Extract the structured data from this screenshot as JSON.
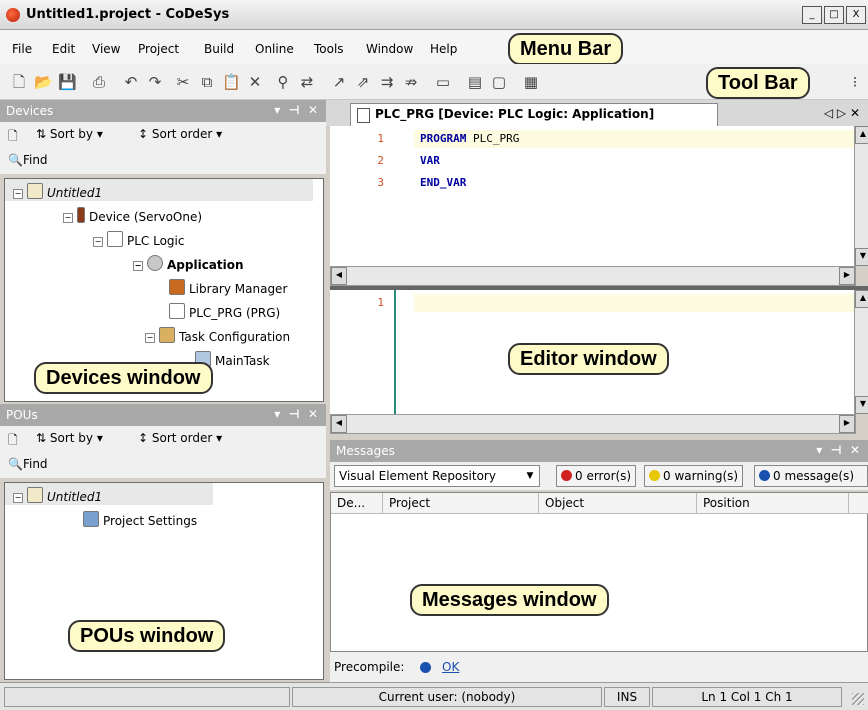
{
  "window": {
    "title": "Untitled1.project - CoDeSys",
    "buttons": [
      "_",
      "□",
      "X"
    ]
  },
  "menu": [
    "File",
    "Edit",
    "View",
    "Project",
    "Build",
    "Online",
    "Tools",
    "Window",
    "Help"
  ],
  "callouts": {
    "menu_bar": "Menu Bar",
    "tool_bar": "Tool Bar",
    "devices_window": "Devices window",
    "editor_window": "Editor window",
    "messages_window": "Messages window",
    "pous_window": "POUs window"
  },
  "devices": {
    "title": "Devices",
    "sort_by": "Sort by",
    "sort_order": "Sort order",
    "find": "Find",
    "tree": [
      {
        "label": "Untitled1",
        "style": "italic"
      },
      {
        "label": "Device (ServoOne)"
      },
      {
        "label": "PLC Logic"
      },
      {
        "label": "Application",
        "style": "bold"
      },
      {
        "label": "Library Manager"
      },
      {
        "label": "PLC_PRG (PRG)"
      },
      {
        "label": "Task Configuration"
      },
      {
        "label": "MainTask"
      }
    ]
  },
  "pous": {
    "title": "POUs",
    "sort_by": "Sort by",
    "sort_order": "Sort order",
    "find": "Find",
    "tree": [
      {
        "label": "Untitled1",
        "style": "italic"
      },
      {
        "label": "Project Settings"
      }
    ]
  },
  "editor": {
    "tab": "PLC_PRG [Device: PLC Logic: Application]",
    "top_lines": [
      {
        "n": "1",
        "kw": "PROGRAM",
        "rest": " PLC_PRG"
      },
      {
        "n": "2",
        "kw": "VAR",
        "rest": ""
      },
      {
        "n": "3",
        "kw": "END_VAR",
        "rest": ""
      }
    ],
    "bottom_lines": [
      {
        "n": "1"
      }
    ]
  },
  "messages": {
    "title": "Messages",
    "source": "Visual Element Repository",
    "errors": "0 error(s)",
    "warnings": "0 warning(s)",
    "messages": "0 message(s)",
    "columns": [
      "De...",
      "Project",
      "Object",
      "Position"
    ],
    "precompile_label": "Precompile:",
    "precompile_status": "OK",
    "colors": {
      "error": "#d02020",
      "warning": "#e8c800",
      "info": "#1a50b0"
    }
  },
  "status": {
    "user": "Current user: (nobody)",
    "mode": "INS",
    "position": "Ln 1  Col 1  Ch 1"
  }
}
